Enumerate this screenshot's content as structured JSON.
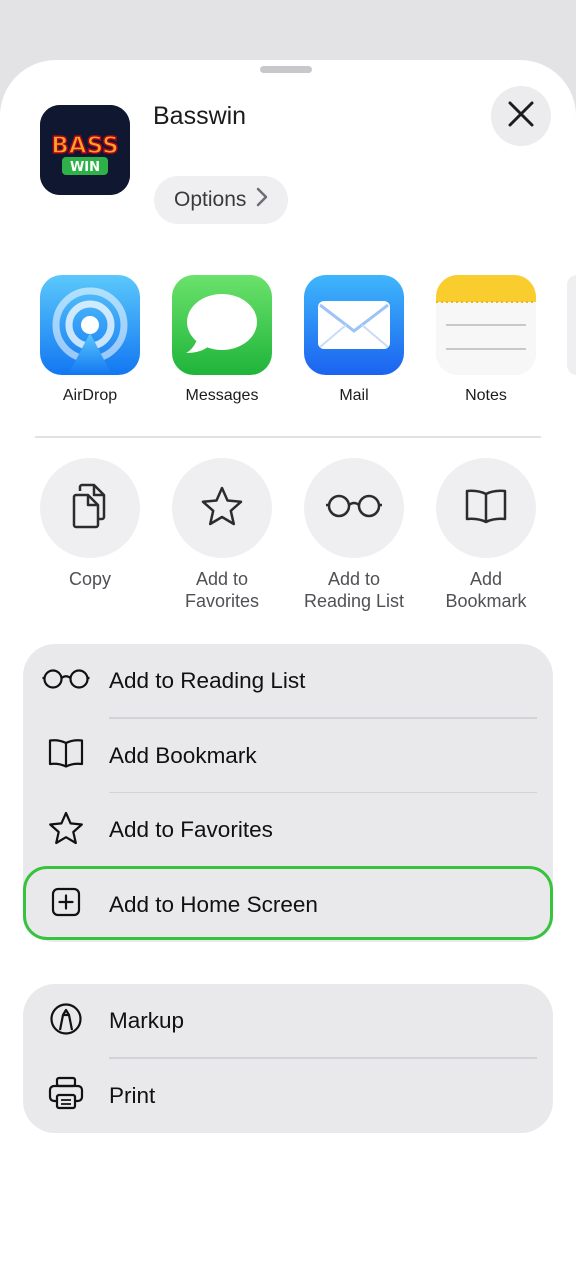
{
  "header": {
    "app_name": "Basswin",
    "options_label": "Options",
    "icon_text_top": "BASS",
    "icon_text_bottom": "WIN"
  },
  "apps": [
    {
      "label": "AirDrop",
      "icon": "airdrop-icon"
    },
    {
      "label": "Messages",
      "icon": "messages-icon"
    },
    {
      "label": "Mail",
      "icon": "mail-icon"
    },
    {
      "label": "Notes",
      "icon": "notes-icon"
    }
  ],
  "actions": [
    {
      "label": "Copy",
      "icon": "copy-icon"
    },
    {
      "label": "Add to Favorites",
      "icon": "star-icon"
    },
    {
      "label": "Add to Reading List",
      "icon": "glasses-icon"
    },
    {
      "label": "Add Bookmark",
      "icon": "book-icon"
    }
  ],
  "list_group_1": [
    {
      "label": "Add to Reading List",
      "icon": "glasses-icon"
    },
    {
      "label": "Add Bookmark",
      "icon": "book-icon"
    },
    {
      "label": "Add to Favorites",
      "icon": "star-icon"
    },
    {
      "label": "Add to Home Screen",
      "icon": "add-square-icon"
    }
  ],
  "list_group_2": [
    {
      "label": "Markup",
      "icon": "markup-icon"
    },
    {
      "label": "Print",
      "icon": "printer-icon"
    }
  ],
  "colors": {
    "highlight": "#38c23d",
    "sheet_bg": "#ffffff",
    "row_bg": "#e9e9eb"
  }
}
